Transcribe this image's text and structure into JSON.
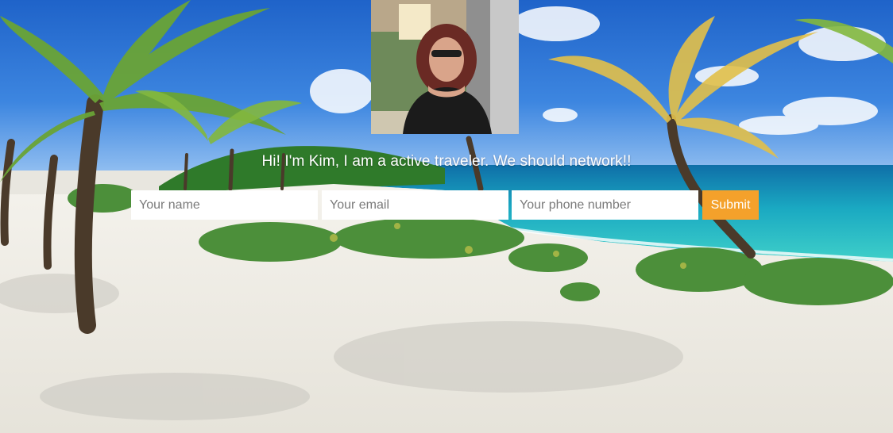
{
  "hero": {
    "background_scene": "tropical-beach-with-palm-trees",
    "profile_photo_alt": "profile-photo",
    "tagline": "Hi! I'm Kim, I am a active traveler. We should network!!"
  },
  "form": {
    "name_placeholder": "Your name",
    "email_placeholder": "Your email",
    "phone_placeholder": "Your phone number",
    "submit_label": "Submit"
  },
  "colors": {
    "accent": "#f4a12b",
    "field_bg": "#ffffff",
    "tagline_text": "#ffffff"
  }
}
